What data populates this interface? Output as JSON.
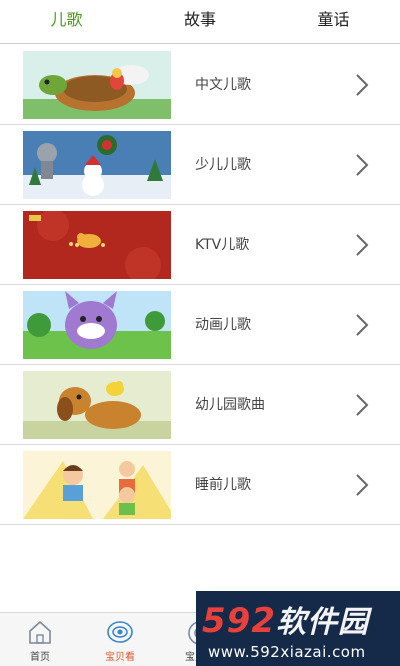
{
  "tabs": [
    {
      "label": "儿歌",
      "active": true
    },
    {
      "label": "故事",
      "active": false
    },
    {
      "label": "童话",
      "active": false
    }
  ],
  "list": [
    {
      "label": "中文儿歌",
      "thumb": "turtle-thumbnail"
    },
    {
      "label": "少儿儿歌",
      "thumb": "christmas-thumbnail"
    },
    {
      "label": "KTV儿歌",
      "thumb": "red-stage-thumbnail"
    },
    {
      "label": "动画儿歌",
      "thumb": "purple-cat-thumbnail"
    },
    {
      "label": "幼儿园歌曲",
      "thumb": "dog-thumbnail"
    },
    {
      "label": "睡前儿歌",
      "thumb": "kids-thumbnail"
    }
  ],
  "bottom_nav": [
    {
      "label": "首页",
      "icon": "home-icon",
      "active": false
    },
    {
      "label": "宝贝看",
      "icon": "eye-icon",
      "active": true
    },
    {
      "label": "宝贝听",
      "icon": "headphone-icon",
      "active": false
    }
  ],
  "watermark": {
    "logo_num": "592",
    "logo_text": "软件园",
    "url": "www.592xiazai.com"
  },
  "colors": {
    "active_tab": "#4c9a1a",
    "active_nav": "#e0572d",
    "watermark_bg": "#152948",
    "watermark_num": "#e8413b"
  }
}
